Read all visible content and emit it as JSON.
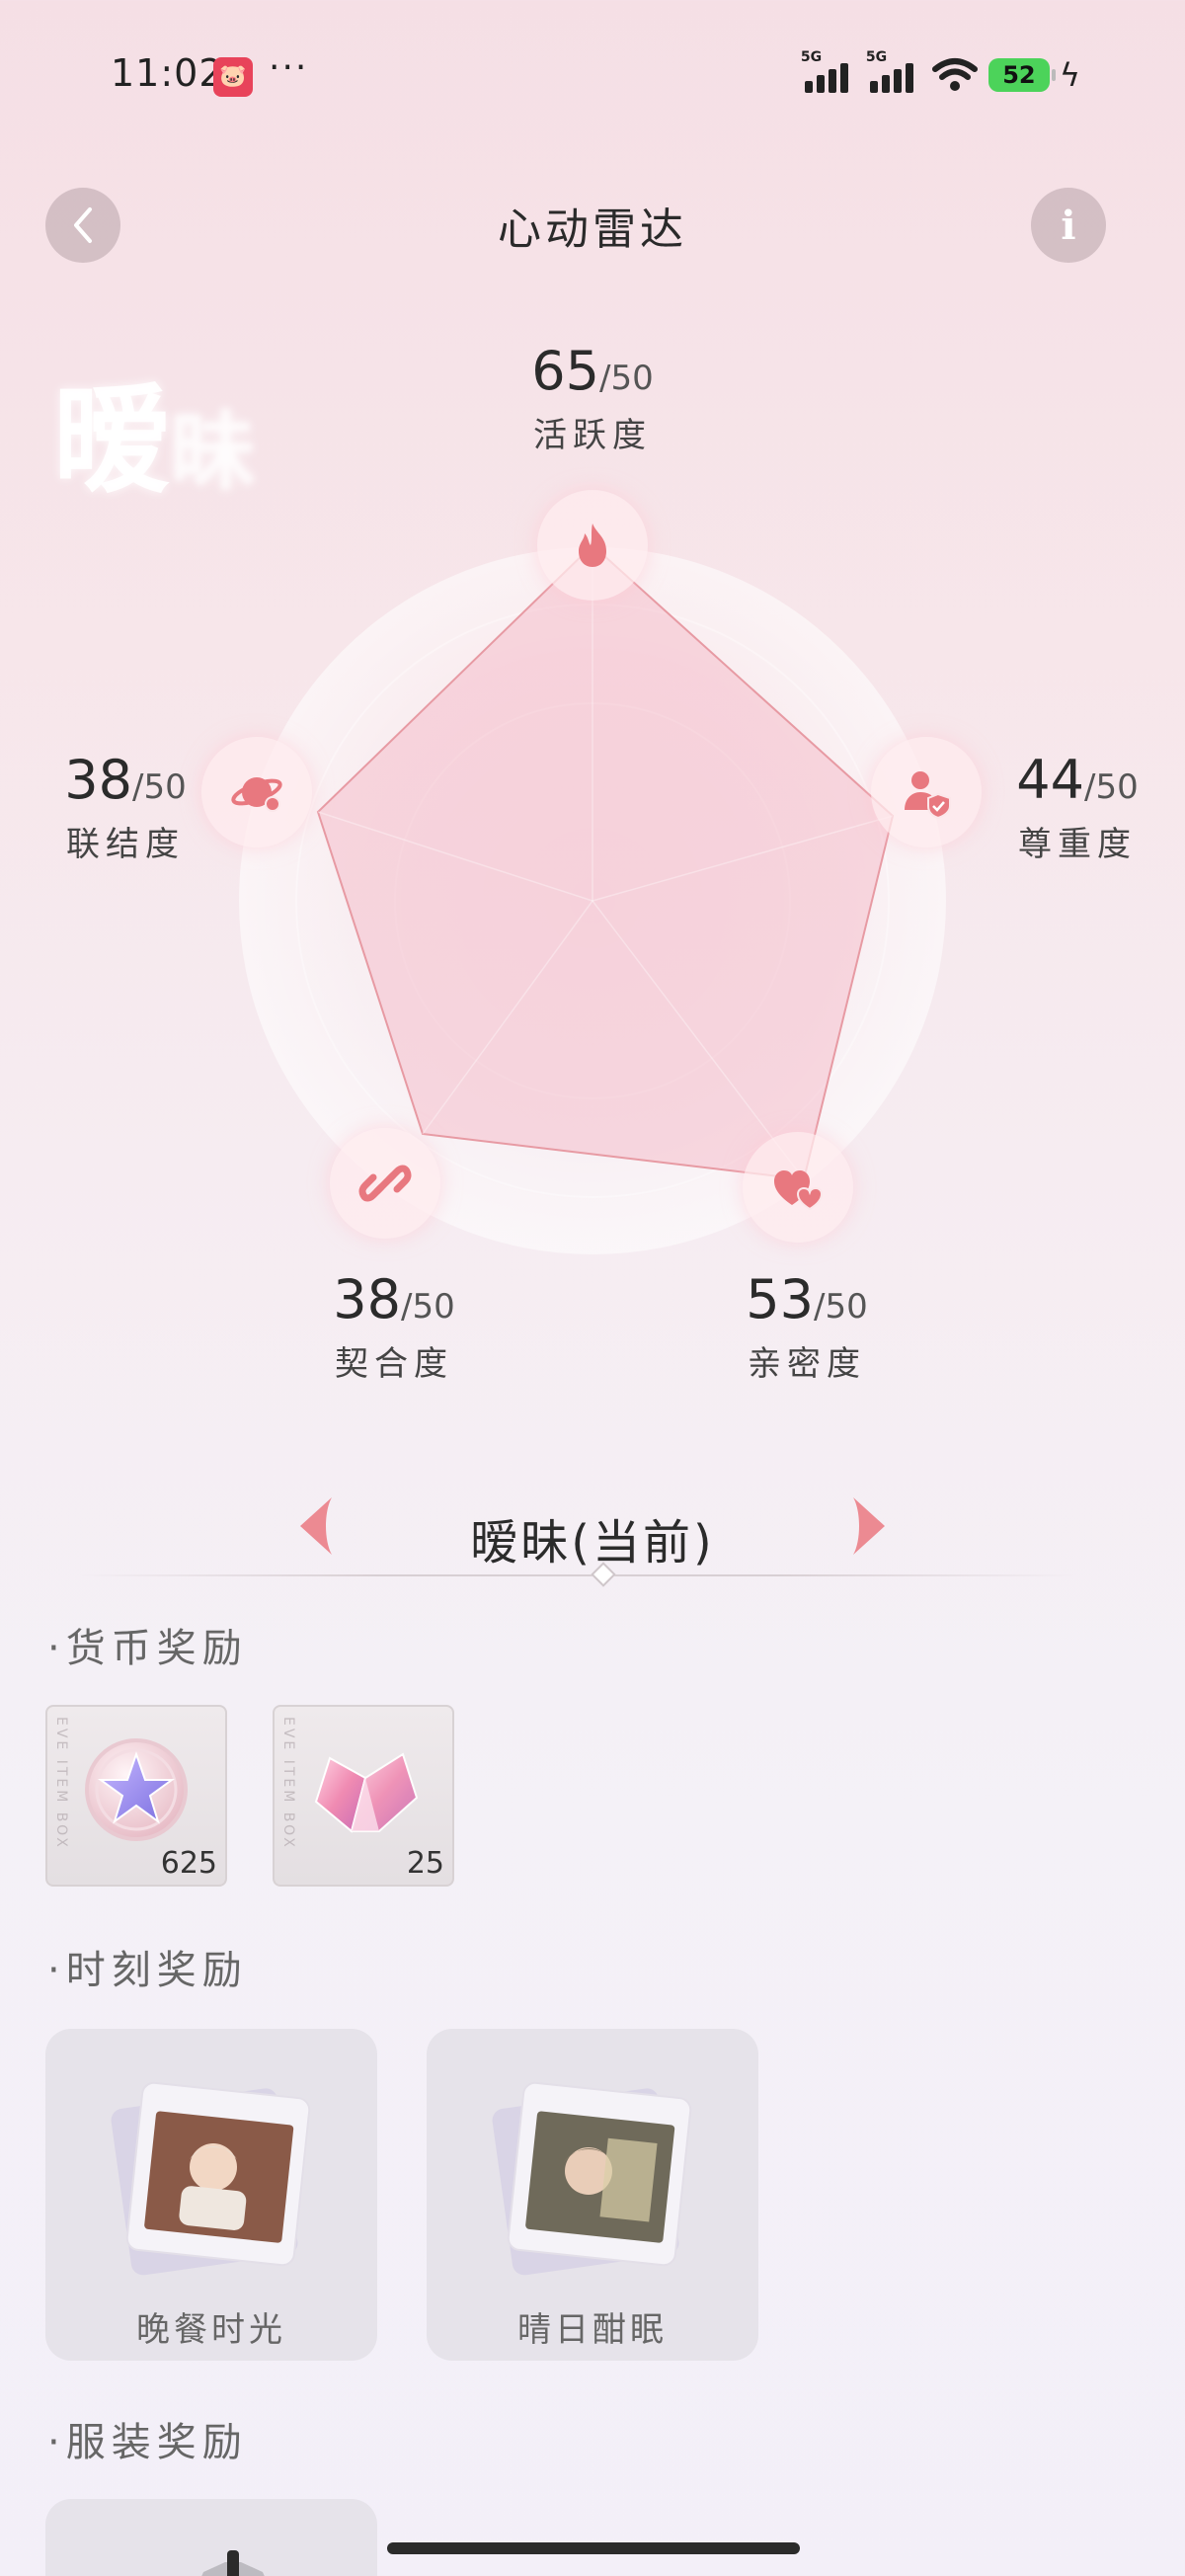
{
  "status_bar": {
    "time": "11:02",
    "app_icon": "pig-app-icon",
    "more": "···",
    "network_1": "5G",
    "network_2": "5G",
    "battery": "52"
  },
  "header": {
    "title": "心动雷达",
    "back_icon": "chevron-left-icon",
    "info_label": "i"
  },
  "stage_watermark": "暧",
  "stage_watermark_fade": "昧",
  "radar": {
    "max": "/50",
    "stats": [
      {
        "key": "activity",
        "label": "活跃度",
        "value": "65",
        "icon": "flame-icon"
      },
      {
        "key": "respect",
        "label": "尊重度",
        "value": "44",
        "icon": "person-shield-icon"
      },
      {
        "key": "intimacy",
        "label": "亲密度",
        "value": "53",
        "icon": "hearts-icon"
      },
      {
        "key": "fit",
        "label": "契合度",
        "value": "38",
        "icon": "link-icon"
      },
      {
        "key": "connection",
        "label": "联结度",
        "value": "38",
        "icon": "planet-icon"
      }
    ]
  },
  "stage": {
    "name": "暧昧(当前)",
    "prev_icon": "triangle-left-icon",
    "next_icon": "triangle-right-icon"
  },
  "sections": {
    "currency": "·货币奖励",
    "moment": "·时刻奖励",
    "outfit": "·服装奖励"
  },
  "currency_rewards": [
    {
      "name": "star-coin",
      "count": "625",
      "watermark": "EVE ITEM BOX"
    },
    {
      "name": "pink-crystal",
      "count": "25",
      "watermark": "EVE ITEM BOX"
    }
  ],
  "moment_rewards": [
    {
      "label": "晚餐时光"
    },
    {
      "label": "晴日酣眠"
    }
  ],
  "colors": {
    "accent_pink": "#e8787f",
    "radar_fill": "#f5c6ce",
    "radar_stroke": "#e79aa3",
    "battery_green": "#4cd35a"
  }
}
